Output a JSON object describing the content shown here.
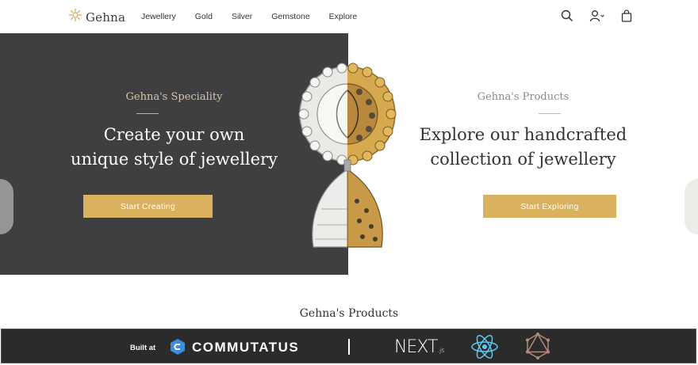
{
  "header": {
    "logo_text": "Gehna",
    "nav": [
      "Jewellery",
      "Gold",
      "Silver",
      "Gemstone",
      "Explore"
    ],
    "icons": [
      "search-icon",
      "user-icon",
      "bag-icon"
    ]
  },
  "hero": {
    "left": {
      "eyebrow": "Gehna's Speciality",
      "headline_line1": "Create your own",
      "headline_line2": "unique style of jewellery",
      "cta": "Start Creating"
    },
    "right": {
      "eyebrow": "Gehna's Products",
      "headline_line1": "Explore our handcrafted",
      "headline_line2": "collection of jewellery",
      "cta": "Start Exploring"
    }
  },
  "section": {
    "title": "Gehna's Products"
  },
  "banner": {
    "built_at": "Built at",
    "brand": "COMMUTATUS",
    "next_text": "NEXT",
    "next_suffix": ".js"
  },
  "colors": {
    "dark_panel": "#3f3f41",
    "accent_gold": "#d9b15f",
    "eyebrow_left": "#d6c5a8",
    "eyebrow_right": "#8a8a8a"
  }
}
